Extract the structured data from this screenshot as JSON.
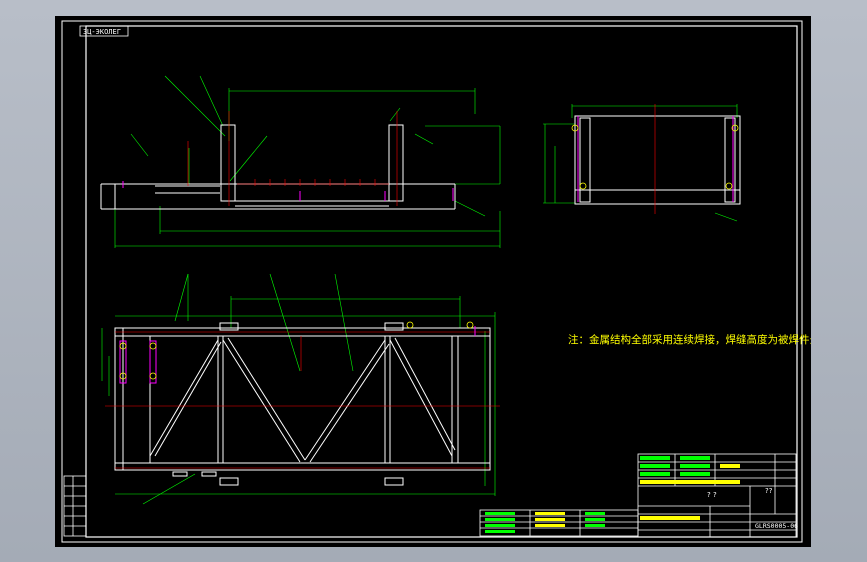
{
  "drawing": {
    "corner_tag": "ЗЦ-ЭКОЛЕГ",
    "note": "注：金属结构全部采用连续焊接，焊缝高度为被焊件最小厚度。",
    "title_block": {
      "unknown_a": "? ?",
      "unknown_b": "??",
      "drawing_number": "GLRS0005-06"
    }
  },
  "colors": {
    "background": "#000000",
    "frame": "#ffffff",
    "cad_green": "#00ff00",
    "cad_red": "#ff0000",
    "cad_magenta": "#ff00ff",
    "cad_yellow": "#ffff00",
    "cad_white": "#ffffff"
  }
}
